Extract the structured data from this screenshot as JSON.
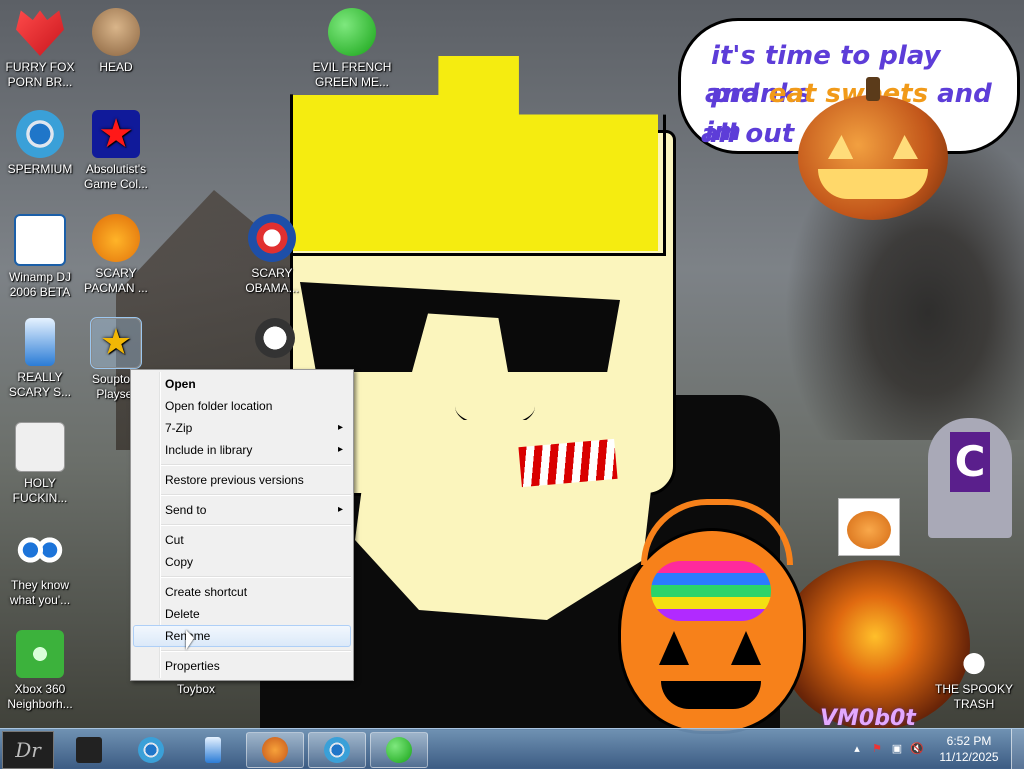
{
  "desktop": {
    "speech_bubble": {
      "line1": "it's time to play pranks",
      "line2_a": "and ",
      "line2_b": "eat sweets",
      "line2_c": " and im",
      "line3": "all out of"
    },
    "watermark": "VM0b0t",
    "grave_letter": "C",
    "icons": [
      {
        "label": "FURRY FOX PORN BR...",
        "icon": "furry-fox-icon"
      },
      {
        "label": "HEAD",
        "icon": "head-icon"
      },
      {
        "label": "EVIL FRENCH GREEN ME...",
        "icon": "msn-icon"
      },
      {
        "label": "SPERMIUM",
        "icon": "chrome-icon"
      },
      {
        "label": "Absolutist's Game Col...",
        "icon": "star-icon"
      },
      {
        "label": "Winamp DJ 2006 BETA",
        "icon": "winamp-icon"
      },
      {
        "label": "SCARY PACMAN ...",
        "icon": "pumpkin-pacman-icon"
      },
      {
        "label": "SCARY OBAMA...",
        "icon": "obama-logo-icon"
      },
      {
        "label": "REALLY SCARY S...",
        "icon": "usb-icon"
      },
      {
        "label": "Soupto... Playset",
        "icon": "exe-icon"
      },
      {
        "label": "HOLY FUCKIN...",
        "icon": "spider-icon"
      },
      {
        "label": "They know what you'...",
        "icon": "eyes-icon"
      },
      {
        "label": "Xbox 360 Neighborh...",
        "icon": "xbox-icon"
      },
      {
        "label": "Toybox",
        "icon": "toybox-icon"
      },
      {
        "label": "THE SPOOKY TRASH",
        "icon": "trash-icon"
      }
    ]
  },
  "context_menu": {
    "items": [
      {
        "label": "Open"
      },
      {
        "label": "Open folder location"
      },
      {
        "label": "7-Zip"
      },
      {
        "label": "Include in library"
      },
      {
        "label": "Restore previous versions"
      },
      {
        "label": "Send to"
      },
      {
        "label": "Cut"
      },
      {
        "label": "Copy"
      },
      {
        "label": "Create shortcut"
      },
      {
        "label": "Delete"
      },
      {
        "label": "Rename"
      },
      {
        "label": "Properties"
      }
    ]
  },
  "taskbar": {
    "start_label": "Dr",
    "items": [
      "folder-icon",
      "chrome-icon",
      "usb-icon",
      "pumpkin-icon",
      "chrome-icon",
      "msn-icon"
    ],
    "clock": {
      "time": "6:52 PM",
      "date": "11/12/2025"
    },
    "colors": {
      "accent": "#5b8ec0"
    }
  }
}
